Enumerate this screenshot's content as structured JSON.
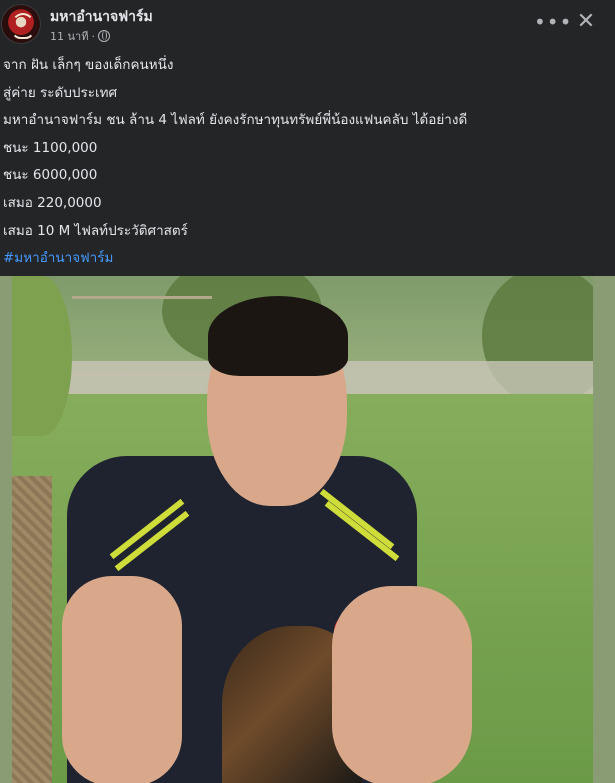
{
  "header": {
    "page_name": "มหาอำนาจฟาร์ม",
    "time": "11 นาที",
    "separator": "·",
    "audience_icon": "globe-icon",
    "more_icon": "more-options-icon",
    "close_icon": "close-icon"
  },
  "post": {
    "lines": [
      "จาก ฝัน เล็กๆ ของเด็กคนหนึ่ง",
      " สู่ค่าย ระดับประเทศ",
      "มหาอำนาจฟาร์ม ชน ล้าน 4 ไฟลท์  ยังคงรักษาทุนทรัพย์พี่น้องแฟนคลับ ได้อย่างดี",
      "ชนะ 1100,000",
      "ชนะ  6000,000",
      "เสมอ  220,0000",
      "เสมอ 10 M ไฟลท์ประวัติศาสตร์"
    ],
    "hashtag": "#มหาอำนาจฟาร์ม"
  },
  "colors": {
    "background": "#242526",
    "text": "#e4e6eb",
    "secondary": "#b0b3b8",
    "link": "#4599ff"
  }
}
